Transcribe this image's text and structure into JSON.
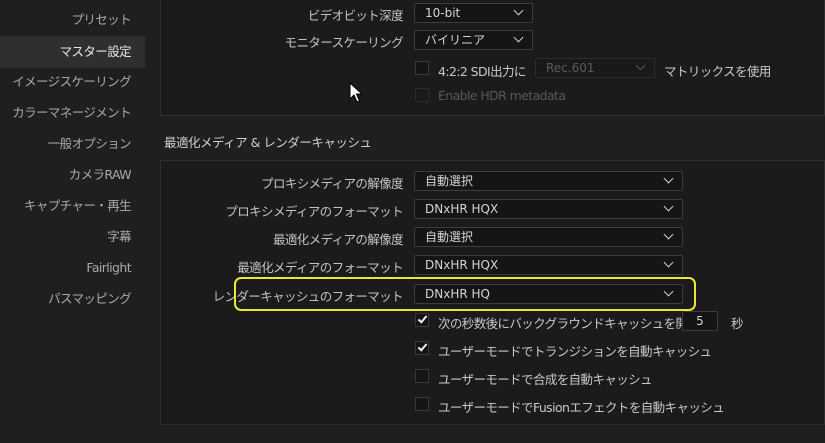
{
  "sidebar": {
    "items": [
      {
        "label": "プリセット"
      },
      {
        "label": "マスター設定"
      },
      {
        "label": "イメージスケーリング"
      },
      {
        "label": "カラーマネージメント"
      },
      {
        "label": "一般オプション"
      },
      {
        "label": "カメラRAW"
      },
      {
        "label": "キャプチャー・再生"
      },
      {
        "label": "字幕"
      },
      {
        "label": "Fairlight"
      },
      {
        "label": "パスマッピング"
      }
    ],
    "active_index": 1
  },
  "video_monitoring": {
    "bit_depth_label": "ビデオビット深度",
    "bit_depth_value": "10-bit",
    "scaling_label": "モニタースケーリング",
    "scaling_value": "バイリニア",
    "sdi_checkbox_label": "4:2:2 SDI出力に",
    "sdi_checked": false,
    "matrix_value": "Rec.601",
    "matrix_suffix": "マトリックスを使用",
    "hdr_label": "Enable HDR metadata",
    "hdr_checked": false
  },
  "cache_section": {
    "title": "最適化メディア & レンダーキャッシュ",
    "rows": [
      {
        "label": "プロキシメディアの解像度",
        "value": "自動選択"
      },
      {
        "label": "プロキシメディアのフォーマット",
        "value": "DNxHR HQX"
      },
      {
        "label": "最適化メディアの解像度",
        "value": "自動選択"
      },
      {
        "label": "最適化メディアのフォーマット",
        "value": "DNxHR HQX"
      },
      {
        "label": "レンダーキャッシュのフォーマット",
        "value": "DNxHR HQ"
      }
    ],
    "bg_cache": {
      "label": "次の秒数後にバックグラウンドキャッシュを開始",
      "checked": true,
      "seconds": "5",
      "unit": "秒"
    },
    "options": [
      {
        "label": "ユーザーモードでトランジションを自動キャッシュ",
        "checked": true
      },
      {
        "label": "ユーザーモードで合成を自動キャッシュ",
        "checked": false
      },
      {
        "label": "ユーザーモードでFusionエフェクトを自動キャッシュ",
        "checked": false
      }
    ]
  },
  "colors": {
    "highlight": "#e9ea2f",
    "background": "#1f1f21",
    "panel": "#1b1b1d"
  }
}
